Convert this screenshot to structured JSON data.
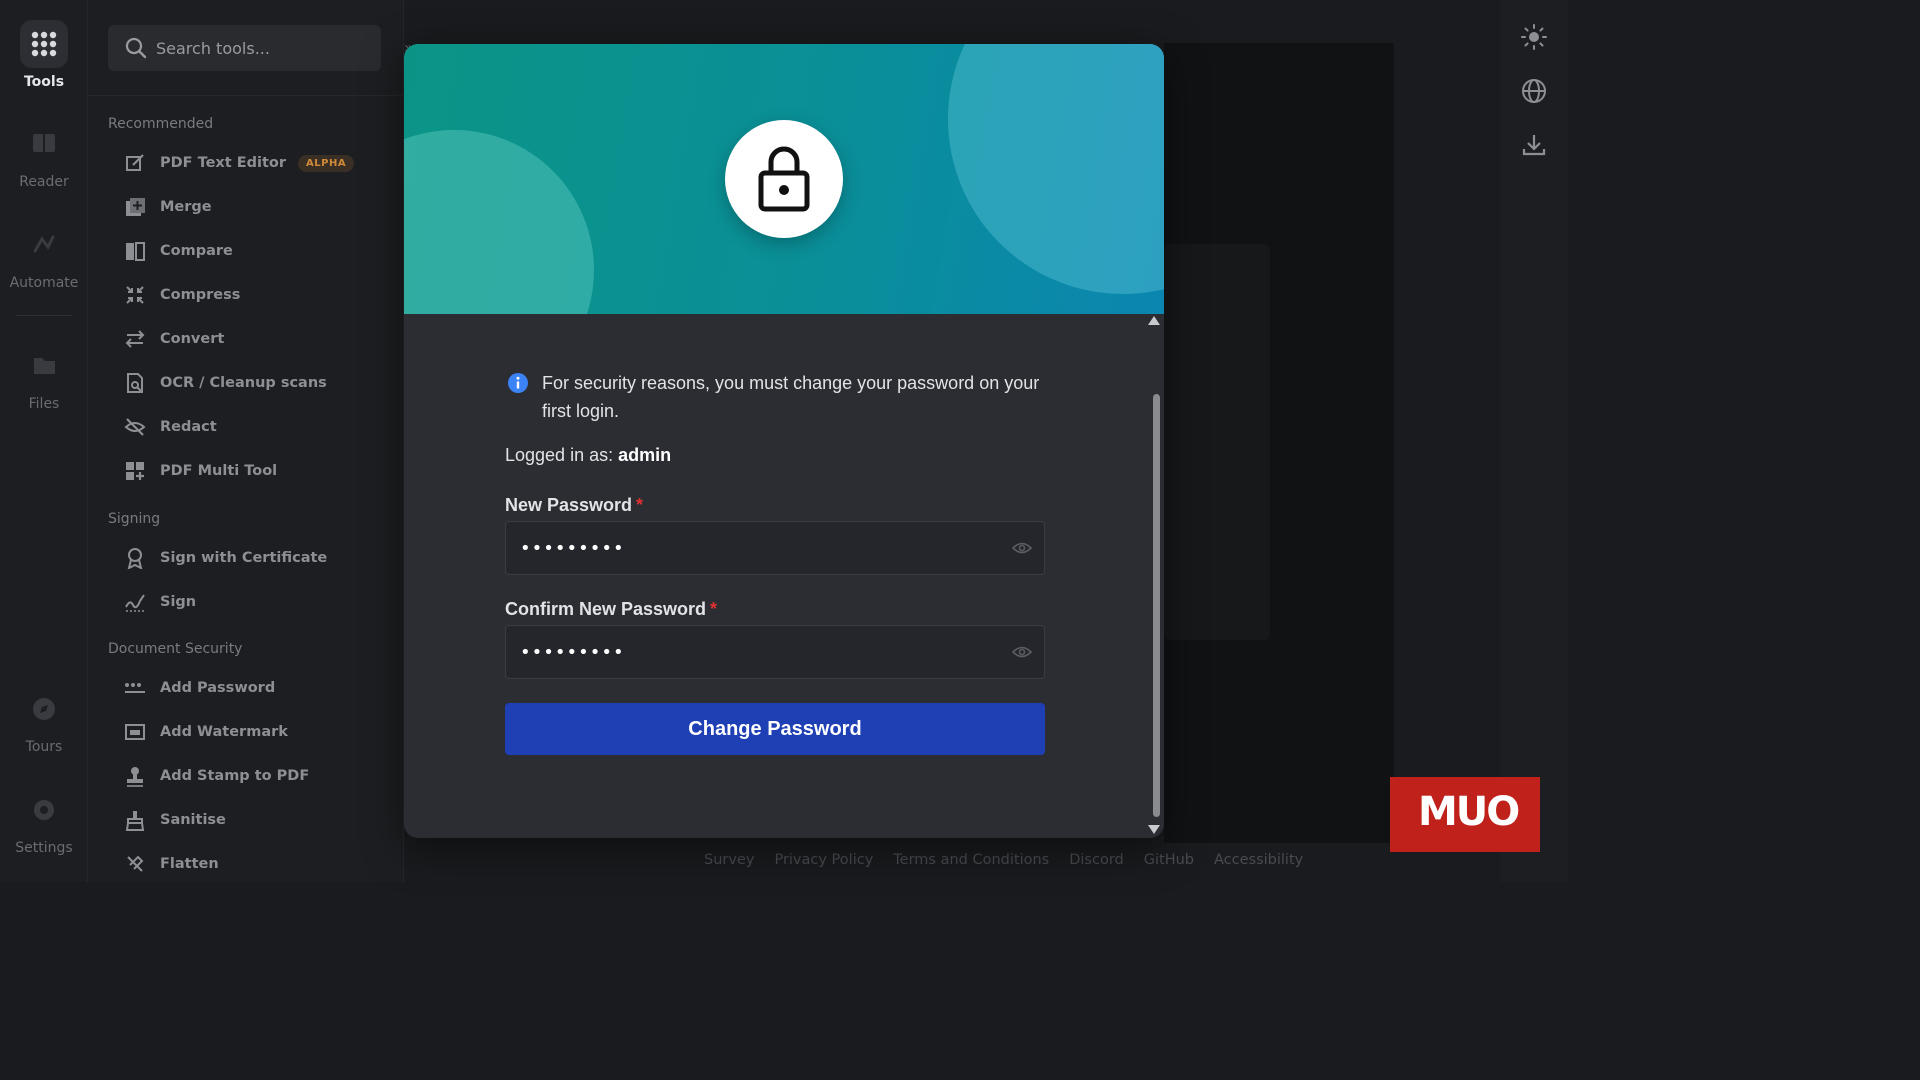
{
  "rail": {
    "items": [
      {
        "label": "Tools",
        "icon": "grid-icon"
      },
      {
        "label": "Reader",
        "icon": "book-icon"
      },
      {
        "label": "Automate",
        "icon": "automate-icon"
      },
      {
        "label": "Files",
        "icon": "folder-icon"
      },
      {
        "label": "Tours",
        "icon": "compass-icon"
      },
      {
        "label": "Settings",
        "icon": "gear-icon"
      }
    ]
  },
  "search": {
    "placeholder": "Search tools..."
  },
  "sections": {
    "recommended": "Recommended",
    "signing": "Signing",
    "document_security": "Document Security"
  },
  "tools": {
    "pdf_text_editor": "PDF Text Editor",
    "alpha_badge": "ALPHA",
    "merge": "Merge",
    "compare": "Compare",
    "compress": "Compress",
    "convert": "Convert",
    "ocr": "OCR / Cleanup scans",
    "redact": "Redact",
    "pdf_multi_tool": "PDF Multi Tool",
    "sign_with_certificate": "Sign with Certificate",
    "sign": "Sign",
    "add_password": "Add Password",
    "add_watermark": "Add Watermark",
    "add_stamp": "Add Stamp to PDF",
    "sanitise": "Sanitise",
    "flatten": "Flatten"
  },
  "footer": {
    "survey": "Survey",
    "privacy": "Privacy Policy",
    "terms": "Terms and Conditions",
    "discord": "Discord",
    "github": "GitHub",
    "accessibility": "Accessibility"
  },
  "modal": {
    "notice": "For security reasons, you must change your password on your first login.",
    "logged_in_prefix": "Logged in as:",
    "username": "admin",
    "new_password_label": "New Password",
    "confirm_password_label": "Confirm New Password",
    "required_mark": "*",
    "new_password_value": "password1",
    "confirm_password_value": "password1",
    "submit_label": "Change Password"
  },
  "watermark": {
    "text": "MUO"
  },
  "colors": {
    "accent": "#1f3fb5",
    "hero_start": "#0b9486",
    "hero_end": "#0b86b0",
    "required": "#e03131",
    "alpha_badge": "#d08a3a"
  }
}
